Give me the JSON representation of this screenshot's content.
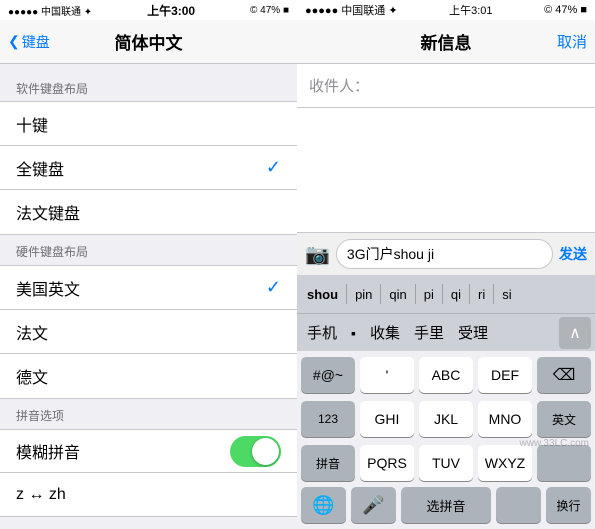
{
  "left": {
    "statusBar": {
      "signal": "●●●●● 中国联通 ✦",
      "time": "上午3:00",
      "battery": "© 47% ■"
    },
    "navBar": {
      "backLabel": "键盘",
      "title": "简体中文"
    },
    "softwareSection": {
      "header": "软件键盘布局",
      "items": [
        {
          "label": "十键",
          "checked": false
        },
        {
          "label": "全键盘",
          "checked": true
        },
        {
          "label": "法文键盘",
          "checked": false
        }
      ]
    },
    "hardwareSection": {
      "header": "硬件键盘布局",
      "items": [
        {
          "label": "美国英文",
          "checked": true
        },
        {
          "label": "法文",
          "checked": false
        },
        {
          "label": "德文",
          "checked": false
        }
      ]
    },
    "pinyinSection": {
      "header": "拼音选项",
      "toggle": {
        "label": "模糊拼音",
        "enabled": true
      },
      "subItem": {
        "label": "z ↔ zh"
      }
    }
  },
  "right": {
    "statusBar": {
      "signal": "●●●●● 中国联通 ✦",
      "time": "上午3:01",
      "battery": "© 47% ■"
    },
    "navBar": {
      "title": "新信息",
      "cancel": "取消"
    },
    "recipient": {
      "label": "收件人："
    },
    "inputBar": {
      "cameraIcon": "📷",
      "typedText": "3G门户shou ji",
      "sendLabel": "发送"
    },
    "pinyinRow": {
      "suggestions": [
        "shou",
        "pin",
        "qin",
        "pi",
        "qi",
        "ri",
        "si"
      ]
    },
    "candidateRow": {
      "words": [
        "手机",
        "▪",
        "收集",
        "手里",
        "受理"
      ],
      "expandIcon": "∧"
    },
    "keyboard": {
      "row1": [
        "#@~",
        "'",
        "ABC",
        "DEF",
        "⌫"
      ],
      "row2": [
        "123",
        "GHI",
        "JKL",
        "MNO",
        "英文"
      ],
      "row3": [
        "拼音",
        "PQRS",
        "TUV",
        "WXYZ",
        ""
      ],
      "row4": [
        "🌐",
        "🎤",
        "选拼音",
        "",
        "换行"
      ]
    },
    "watermark": "www.33LC.com"
  }
}
